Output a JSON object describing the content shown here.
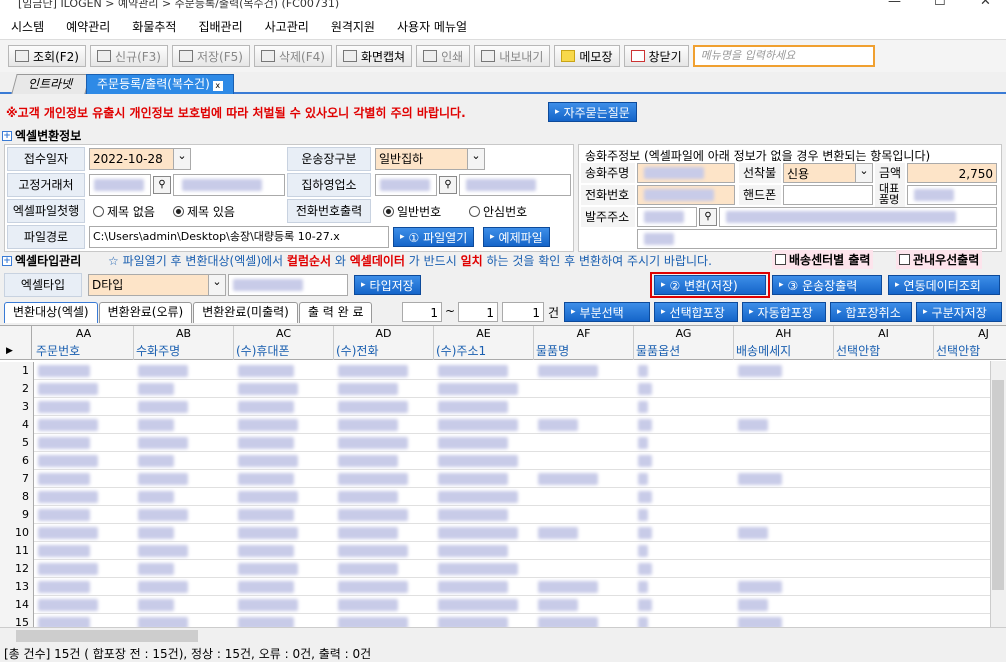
{
  "window": {
    "title": "[임금단] ILOGEN > 예약관리 > 주문등록/출력(복수건) (FC00731)"
  },
  "menu": [
    "시스템",
    "예약관리",
    "화물추적",
    "집배관리",
    "사고관리",
    "원격지원",
    "사용자 메뉴얼"
  ],
  "toolbar": {
    "buttons": [
      "조회(F2)",
      "신규(F3)",
      "저장(F5)",
      "삭제(F4)",
      "화면캡쳐",
      "인쇄",
      "내보내기",
      "메모장",
      "창닫기"
    ],
    "search_placeholder": "메뉴명을 입력하세요"
  },
  "tabs": {
    "tab1": "인트라넷",
    "tab2": "주문등록/출력(복수건)",
    "close_glyph": "x"
  },
  "warning": {
    "text": "※고객 개인정보 유출시 개인정보 보호법에 따라 처벌될 수 있사오니 각별히 주의 바랍니다.",
    "faq_button": "자주묻는질문"
  },
  "excel_section": {
    "title": "엑셀변환정보",
    "receipt_date_label": "접수일자",
    "receipt_date": "2022-10-28",
    "transport_label": "운송장구분",
    "transport_value": "일반집하",
    "fixed_client_label": "고정거래처",
    "collection_office_label": "집하영업소",
    "excel_first_row_label": "엑셀파일첫행",
    "radio_no_title": "제목 없음",
    "radio_with_title": "제목 있음",
    "phone_output_label": "전화번호출력",
    "radio_normal": "일반번호",
    "radio_safe": "안심번호",
    "file_path_label": "파일경로",
    "file_path": "C:\\Users\\admin\\Desktop\\송장\\대량등록 10-27.x",
    "open_file_button": "① 파일열기",
    "example_file_button": "예제파일"
  },
  "sender_panel": {
    "title": "송화주정보 (엑셀파일에 아래 정보가 없을 경우 변환되는 항목입니다)",
    "sender_name_label": "송화주명",
    "payment_label": "선착불",
    "payment_value": "신용",
    "amount_label": "금액",
    "amount_value": "2,750",
    "phone_label": "전화번호",
    "mobile_label": "핸드폰",
    "rep_item_label": "대표품명",
    "address_label": "발주주소"
  },
  "notice": {
    "prefix": "☆ 파일열기 후 변환대상(엑셀)에서 ",
    "kw1": "컬럼순서",
    "mid1": " 와 ",
    "kw2": "엑셀데이터",
    "mid2": " 가 반드시 ",
    "kw3": "일치",
    "suffix": " 하는 것을 확인 후 변환하여 주시기 바랍니다.",
    "chk1": "배송센터별 출력",
    "chk2": "관내우선출력"
  },
  "type_section": {
    "title": "엑셀타입관리",
    "type_label": "엑셀타입",
    "type_value": "D타입",
    "save_type_button": "타입저장",
    "convert_button": "② 변환(저장)",
    "print_button": "③ 운송장출력",
    "linked_button": "연동데이터조회"
  },
  "subtabs": [
    "변환대상(엑셀)",
    "변환완료(오류)",
    "변환완료(미출력)",
    "출 력 완 료"
  ],
  "range": {
    "from": "1",
    "tilde": "~",
    "to": "1",
    "count": "1",
    "unit": "건"
  },
  "action_buttons": [
    "부분선택",
    "선택합포장",
    "자동합포장",
    "합포장취소",
    "구분자저장"
  ],
  "grid": {
    "col_letters": [
      "AA",
      "AB",
      "AC",
      "AD",
      "AE",
      "AF",
      "AG",
      "AH",
      "AI",
      "AJ"
    ],
    "col_names": [
      "주문번호",
      "수화주명",
      "(수)휴대폰",
      "(수)전화",
      "(수)주소1",
      "물품명",
      "물품옵션",
      "배송메세지",
      "선택안함",
      "선택안함"
    ],
    "rows": [
      "1",
      "2",
      "3",
      "4",
      "5",
      "6",
      "7",
      "8",
      "9",
      "10",
      "11",
      "12",
      "13",
      "14",
      "15"
    ]
  },
  "status": "[총 건수] 15건 ( 합포장 전 : 15건), 정상 : 15건, 오류 : 0건, 출력 : 0건"
}
